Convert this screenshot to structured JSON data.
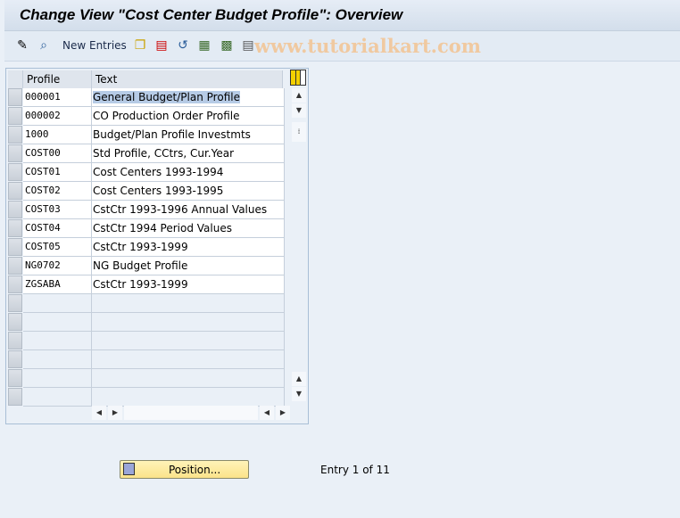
{
  "title": "Change View \"Cost Center Budget Profile\": Overview",
  "toolbar": {
    "icons": [
      "display-change-icon",
      "find-icon",
      "new-entries",
      "copy-icon",
      "delete-icon",
      "undo-icon",
      "select-all-icon",
      "select-block-icon",
      "deselect-all-icon"
    ],
    "new_entries_label": "New Entries"
  },
  "watermark": "www.tutorialkart.com",
  "table": {
    "columns": [
      "Profile",
      "Text"
    ],
    "rows": [
      {
        "profile": "000001",
        "text": "General Budget/Plan Profile"
      },
      {
        "profile": "000002",
        "text": "CO Production Order Profile"
      },
      {
        "profile": "1000",
        "text": "Budget/Plan Profile Investmts"
      },
      {
        "profile": "COST00",
        "text": "Std Profile, CCtrs, Cur.Year"
      },
      {
        "profile": "COST01",
        "text": "Cost Centers 1993-1994"
      },
      {
        "profile": "COST02",
        "text": "Cost Centers 1993-1995"
      },
      {
        "profile": "COST03",
        "text": "CstCtr 1993-1996 Annual Values"
      },
      {
        "profile": "COST04",
        "text": "CstCtr 1994 Period Values"
      },
      {
        "profile": "COST05",
        "text": "CstCtr 1993-1999"
      },
      {
        "profile": "NG0702",
        "text": "NG Budget Profile"
      },
      {
        "profile": "ZGSABA",
        "text": "CstCtr 1993-1999"
      }
    ],
    "empty_rows": 6
  },
  "footer": {
    "position_label": "Position...",
    "entry_text": "Entry 1 of 11"
  }
}
